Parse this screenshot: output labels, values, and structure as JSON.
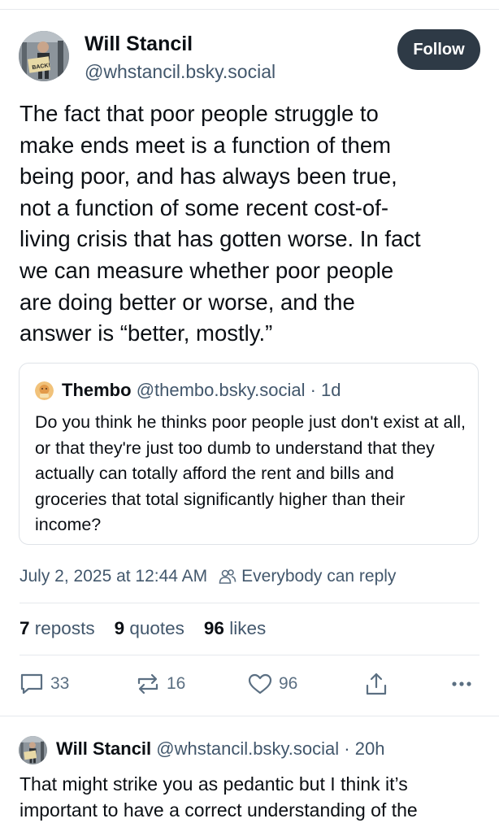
{
  "post": {
    "author_name": "Will Stancil",
    "author_handle": "@whstancil.bsky.social",
    "follow_label": "Follow",
    "avatar_sign_text": "BACK!",
    "text": "The fact that poor people struggle to\nmake ends meet is a function of them\nbeing poor, and has always been true,\nnot a function of some recent cost-of-\nliving crisis that has gotten worse. In fact\nwe can measure whether poor people\nare doing better or worse, and the\nanswer is “better, mostly.”",
    "timestamp": "July 2, 2025 at 12:44 AM",
    "reply_setting": "Everybody can reply"
  },
  "quote": {
    "name": "Thembo",
    "handle": "@thembo.bsky.social",
    "age": "· 1d",
    "text": "Do you think he thinks poor people just don't exist at all, or that they're just too dumb to understand that they actually can totally afford the rent and bills and groceries that total significantly higher than their income?"
  },
  "stats": {
    "reposts_count": "7",
    "reposts_label": "reposts",
    "quotes_count": "9",
    "quotes_label": "quotes",
    "likes_count": "96",
    "likes_label": "likes"
  },
  "actions": {
    "reply_count": "33",
    "repost_count": "16",
    "like_count": "96",
    "icons": [
      "reply-icon",
      "repost-icon",
      "like-icon",
      "share-icon",
      "more-icon"
    ]
  },
  "reply": {
    "name": "Will Stancil",
    "handle": "@whstancil.bsky.social",
    "age": "· 20h",
    "text": "That might strike you as pedantic but I think it’s important to have a correct understanding of the"
  },
  "colors": {
    "text": "#0b0f14",
    "muted": "#42576c",
    "follow_bg": "#2e3a46",
    "divider": "#e6e9ed"
  }
}
